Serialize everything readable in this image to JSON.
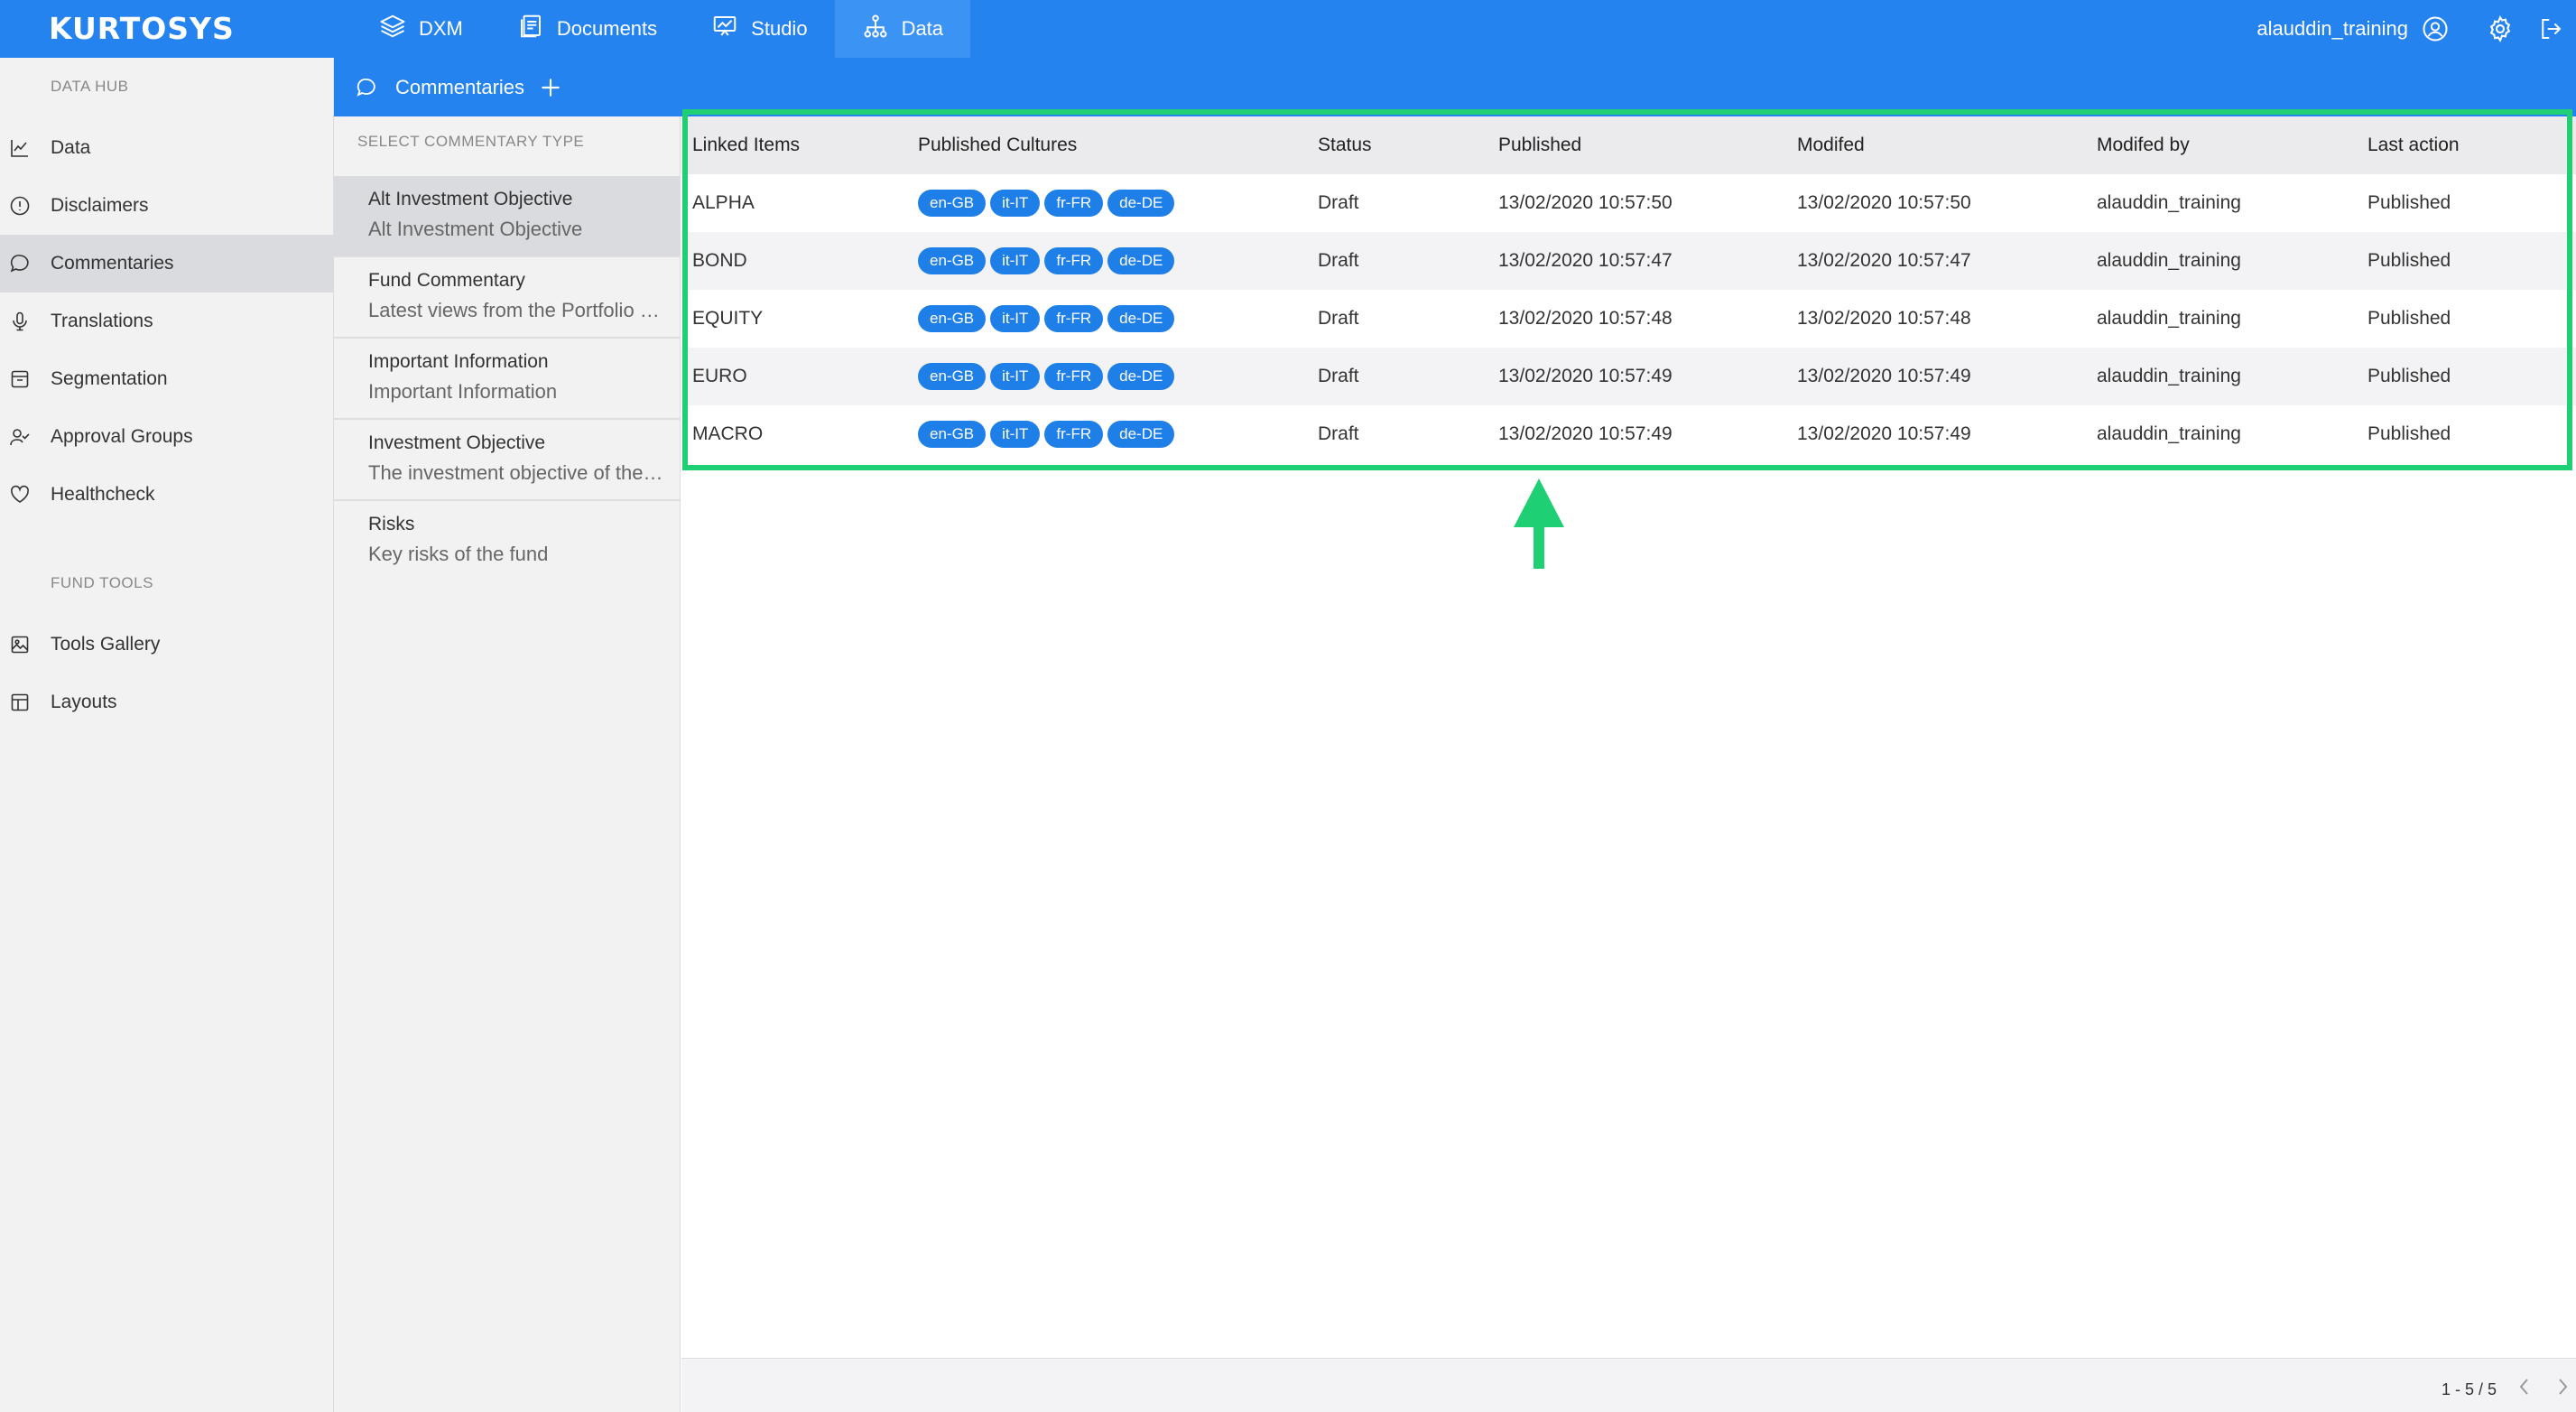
{
  "app": {
    "logo": "KURTOSYS"
  },
  "topnav": {
    "items": [
      {
        "label": "DXM",
        "icon": "layers-icon"
      },
      {
        "label": "Documents",
        "icon": "documents-icon"
      },
      {
        "label": "Studio",
        "icon": "presentation-icon"
      },
      {
        "label": "Data",
        "icon": "hierarchy-icon",
        "active": true
      }
    ]
  },
  "user": {
    "name": "alauddin_training"
  },
  "sidebar": {
    "section1": "DATA HUB",
    "items": [
      {
        "label": "Data",
        "icon": "chart-icon"
      },
      {
        "label": "Disclaimers",
        "icon": "alert-circle-icon"
      },
      {
        "label": "Commentaries",
        "icon": "comment-icon",
        "active": true
      },
      {
        "label": "Translations",
        "icon": "microphone-icon"
      },
      {
        "label": "Segmentation",
        "icon": "inbox-icon"
      },
      {
        "label": "Approval Groups",
        "icon": "user-check-icon"
      },
      {
        "label": "Healthcheck",
        "icon": "heart-icon"
      }
    ],
    "section2": "FUND TOOLS",
    "tools": [
      {
        "label": "Tools Gallery",
        "icon": "image-icon"
      },
      {
        "label": "Layouts",
        "icon": "layout-icon"
      }
    ]
  },
  "subheader": {
    "title": "Commentaries"
  },
  "commentary_types": {
    "heading": "SELECT COMMENTARY TYPE",
    "items": [
      {
        "title": "Alt Investment Objective",
        "subtitle": "Alt Investment Objective",
        "active": true
      },
      {
        "title": "Fund Commentary",
        "subtitle": "Latest views from the Portfolio Manager"
      },
      {
        "title": "Important Information",
        "subtitle": "Important Information"
      },
      {
        "title": "Investment Objective",
        "subtitle": "The investment objective of the fund"
      },
      {
        "title": "Risks",
        "subtitle": "Key risks of the fund"
      }
    ]
  },
  "table": {
    "headers": [
      "Linked Items",
      "Published Cultures",
      "Status",
      "Published",
      "Modifed",
      "Modifed by",
      "Last action"
    ],
    "cultures": [
      "en-GB",
      "it-IT",
      "fr-FR",
      "de-DE"
    ],
    "rows": [
      {
        "item": "ALPHA",
        "status": "Draft",
        "published": "13/02/2020 10:57:50",
        "modified": "13/02/2020 10:57:50",
        "modified_by": "alauddin_training",
        "last_action": "Published"
      },
      {
        "item": "BOND",
        "status": "Draft",
        "published": "13/02/2020 10:57:47",
        "modified": "13/02/2020 10:57:47",
        "modified_by": "alauddin_training",
        "last_action": "Published"
      },
      {
        "item": "EQUITY",
        "status": "Draft",
        "published": "13/02/2020 10:57:48",
        "modified": "13/02/2020 10:57:48",
        "modified_by": "alauddin_training",
        "last_action": "Published"
      },
      {
        "item": "EURO",
        "status": "Draft",
        "published": "13/02/2020 10:57:49",
        "modified": "13/02/2020 10:57:49",
        "modified_by": "alauddin_training",
        "last_action": "Published"
      },
      {
        "item": "MACRO",
        "status": "Draft",
        "published": "13/02/2020 10:57:49",
        "modified": "13/02/2020 10:57:49",
        "modified_by": "alauddin_training",
        "last_action": "Published"
      }
    ]
  },
  "pagination": {
    "range": "1 - 5 / 5"
  },
  "colors": {
    "brand": "#2583f0",
    "chip": "#1e7fe8",
    "highlight": "#1fcf74"
  }
}
